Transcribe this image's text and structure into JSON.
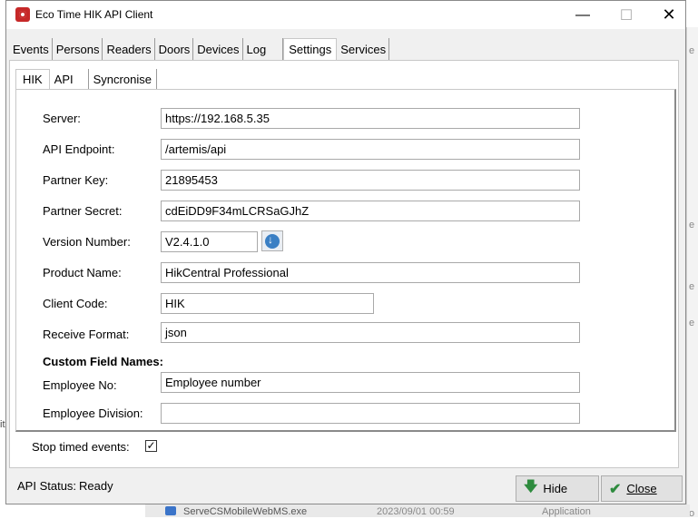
{
  "window": {
    "title": "Eco Time HIK API Client",
    "minimize": "—",
    "maximize": "☐",
    "close": "✕"
  },
  "outer_tabs": [
    "Events",
    "Persons",
    "Readers",
    "Doors",
    "Devices",
    "Log",
    "Settings",
    "Services"
  ],
  "outer_active": "Settings",
  "inner_tabs": [
    "HIK",
    "API",
    "Syncronise"
  ],
  "inner_active": "HIK",
  "form": {
    "server_label": "Server:",
    "server_value": "https://192.168.5.35",
    "endpoint_label": "API Endpoint:",
    "endpoint_value": "/artemis/api",
    "partner_key_label": "Partner Key:",
    "partner_key_value": "21895453",
    "partner_secret_label": "Partner Secret:",
    "partner_secret_value": "cdEiDD9F34mLCRSaGJhZ",
    "version_label": "Version Number:",
    "version_value": "V2.4.1.0",
    "product_label": "Product Name:",
    "product_value": "HikCentral Professional",
    "client_code_label": "Client Code:",
    "client_code_value": "HIK",
    "receive_format_label": "Receive Format:",
    "receive_format_value": "json",
    "custom_heading": "Custom Field Names:",
    "employee_no_label": "Employee No:",
    "employee_no_value": "Employee number",
    "employee_division_label": "Employee Division:",
    "employee_division_value": ""
  },
  "stop_timed_events": {
    "label": "Stop timed events:",
    "checked": "✓"
  },
  "status": {
    "label": "API Status:",
    "value": "Ready"
  },
  "buttons": {
    "hide": "Hide",
    "close": "Close"
  },
  "background": {
    "row_name": "ServeCSMobileWebMS.exe",
    "row_date": "2023/09/01 00:59",
    "row_type": "Application",
    "left_char": "it",
    "right_chars": [
      "e",
      "e",
      "e",
      "e",
      "o"
    ]
  },
  "icons": {
    "app": "app-camera-icon",
    "download": "cloud-download-icon",
    "hide": "arrow-down-icon",
    "close": "checkmark-icon"
  },
  "colors": {
    "accent_green": "#2e8b3e",
    "app_red": "#c62828",
    "download_blue": "#3a7fc4"
  }
}
